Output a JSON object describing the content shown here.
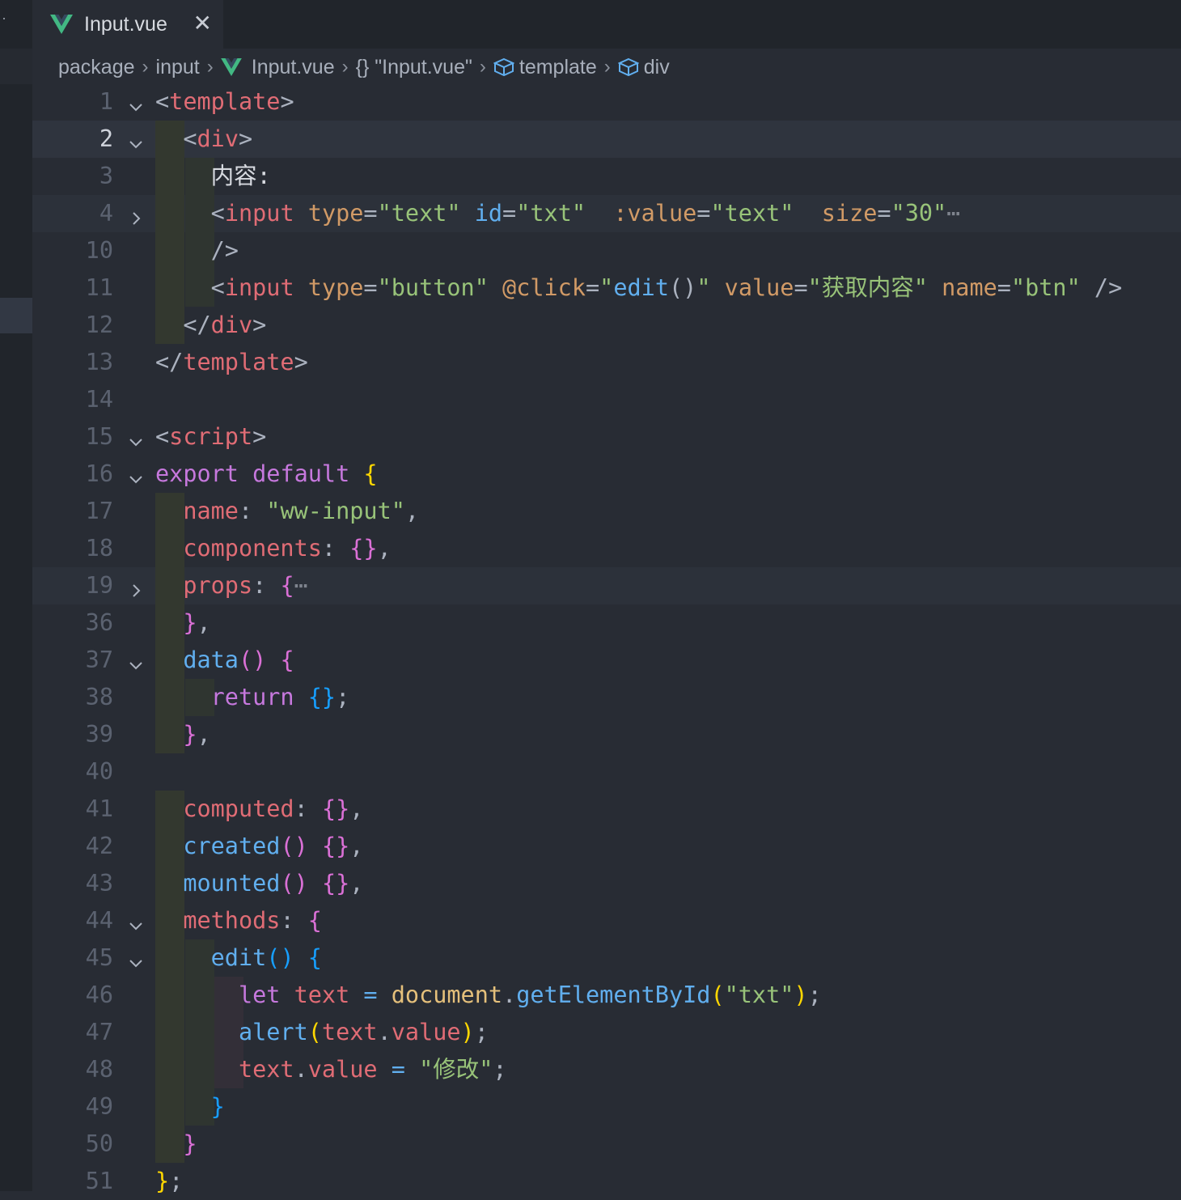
{
  "tab": {
    "label": "Input.vue",
    "close": "✕"
  },
  "breadcrumb": {
    "items": [
      "package",
      "input",
      "Input.vue",
      "{} \"Input.vue\"",
      "template",
      "div"
    ],
    "separator": "›"
  },
  "colors": {
    "background": "#282c34",
    "tag": "#e06c75",
    "keyword": "#c678dd",
    "string": "#98c379",
    "function": "#61afef",
    "attribute": "#d19a66",
    "vue_green": "#42b883"
  },
  "editor": {
    "active_line": "2",
    "lines": [
      {
        "n": "1",
        "fold": "open",
        "code": "<template>"
      },
      {
        "n": "2",
        "fold": "open",
        "code": "  <div>"
      },
      {
        "n": "3",
        "fold": "",
        "code": "    内容:"
      },
      {
        "n": "4",
        "fold": "closed",
        "code": "    <input type=\"text\" id=\"txt\"  :value=\"text\"  size=\"30\"⋯"
      },
      {
        "n": "10",
        "fold": "",
        "code": "    />"
      },
      {
        "n": "11",
        "fold": "",
        "code": "    <input type=\"button\" @click=\"edit()\" value=\"获取内容\" name=\"btn\" />"
      },
      {
        "n": "12",
        "fold": "",
        "code": "  </div>"
      },
      {
        "n": "13",
        "fold": "",
        "code": "</template>"
      },
      {
        "n": "14",
        "fold": "",
        "code": ""
      },
      {
        "n": "15",
        "fold": "open",
        "code": "<script>"
      },
      {
        "n": "16",
        "fold": "open",
        "code": "export default {"
      },
      {
        "n": "17",
        "fold": "",
        "code": "  name: \"ww-input\","
      },
      {
        "n": "18",
        "fold": "",
        "code": "  components: {},"
      },
      {
        "n": "19",
        "fold": "closed",
        "code": "  props: {⋯"
      },
      {
        "n": "36",
        "fold": "",
        "code": "  },"
      },
      {
        "n": "37",
        "fold": "open",
        "code": "  data() {"
      },
      {
        "n": "38",
        "fold": "",
        "code": "    return {};"
      },
      {
        "n": "39",
        "fold": "",
        "code": "  },"
      },
      {
        "n": "40",
        "fold": "",
        "code": ""
      },
      {
        "n": "41",
        "fold": "",
        "code": "  computed: {},"
      },
      {
        "n": "42",
        "fold": "",
        "code": "  created() {},"
      },
      {
        "n": "43",
        "fold": "",
        "code": "  mounted() {},"
      },
      {
        "n": "44",
        "fold": "open",
        "code": "  methods: {"
      },
      {
        "n": "45",
        "fold": "open",
        "code": "    edit() {"
      },
      {
        "n": "46",
        "fold": "",
        "code": "      let text = document.getElementById(\"txt\");"
      },
      {
        "n": "47",
        "fold": "",
        "code": "      alert(text.value);"
      },
      {
        "n": "48",
        "fold": "",
        "code": "      text.value = \"修改\";"
      },
      {
        "n": "49",
        "fold": "",
        "code": "    }"
      },
      {
        "n": "50",
        "fold": "",
        "code": "  }"
      },
      {
        "n": "51",
        "fold": "",
        "code": "};"
      }
    ]
  }
}
